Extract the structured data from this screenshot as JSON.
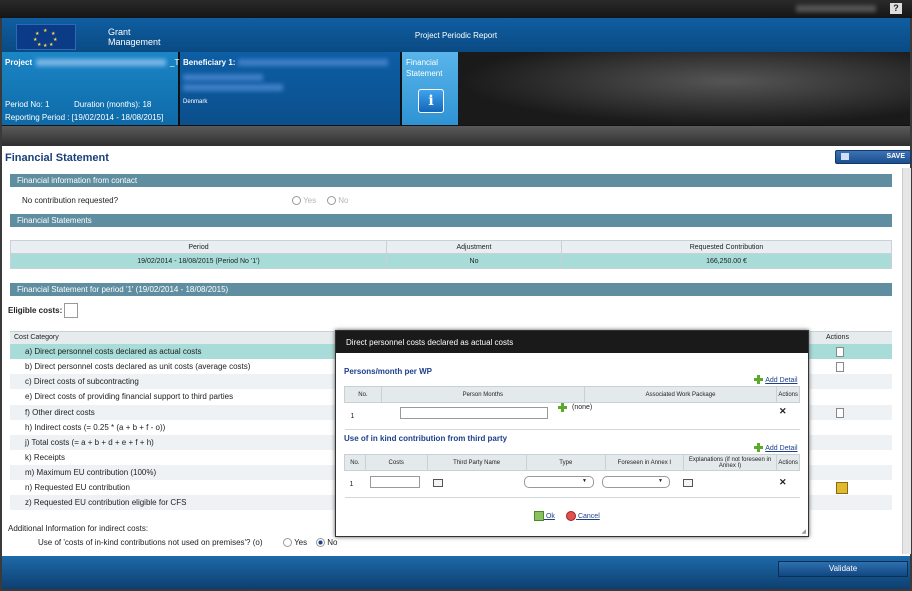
{
  "topbar": {
    "help": "?"
  },
  "branding": {
    "name_line1": "Grant",
    "name_line2": "Management",
    "app_title": "Project Periodic Report"
  },
  "header": {
    "project_label": "Project",
    "project_suffix": "_T",
    "period_no": "Period No: 1",
    "duration": "Duration (months): 18",
    "reporting_period": "Reporting Period : [19/02/2014 - 18/08/2015]",
    "beneficiary_label": "Beneficiary 1:",
    "beneficiary_country": "Denmark",
    "financial_tab_line1": "Financial",
    "financial_tab_line2": "Statement",
    "info_icon": "i"
  },
  "page": {
    "title": "Financial Statement",
    "save_label": "SAVE"
  },
  "contact_section": {
    "title": "Financial information from contact",
    "question": "No contribution requested?",
    "yes": "Yes",
    "no": "No"
  },
  "statements_section": {
    "title": "Financial Statements",
    "columns": [
      "Period",
      "Adjustment",
      "Requested Contribution"
    ],
    "rows": [
      [
        "19/02/2014 - 18/08/2015 (Period No '1')",
        "No",
        "166,250.00 €"
      ]
    ]
  },
  "period_section": {
    "title": "Financial Statement for period '1' (19/02/2014 - 18/08/2015)",
    "eligible_costs": "Eligible costs:"
  },
  "cost_table": {
    "header_category": "Cost Category",
    "header_actions": "Actions",
    "rows": [
      "a) Direct personnel costs declared as actual costs",
      "b) Direct personnel costs declared as unit costs (average costs)",
      "c) Direct costs of subcontracting",
      "e) Direct costs of providing financial support to third parties",
      "f) Other direct costs",
      "h) Indirect costs (= 0.25 * (a + b + f - o))",
      "j) Total costs (= a + b + d + e + f + h)",
      "k) Receipts",
      "m) Maximum EU contribution (100%)",
      "n) Requested EU contribution",
      "z) Requested EU contribution eligible for CFS"
    ]
  },
  "additional": {
    "title": "Additional Information for indirect costs:",
    "question": "Use of 'costs of in-kind contributions not used on premises'? (o)",
    "yes": "Yes",
    "no": "No"
  },
  "footer": {
    "validate": "Validate"
  },
  "modal": {
    "title": "Direct personnel costs declared as actual costs",
    "persons_title": "Persons/month per WP",
    "add_detail": "Add Detail",
    "persons_columns": [
      "No.",
      "Person Months",
      "Associated Work Package",
      "Actions"
    ],
    "persons_row_no": "1",
    "persons_row_wp": "(none)",
    "inkind_title": "Use of in kind contribution from third party",
    "inkind_columns": [
      "No.",
      "Costs",
      "Third Party Name",
      "Type",
      "Foreseen in Annex I",
      "Explanations (if not foreseen in Annex I)",
      "Actions"
    ],
    "inkind_row_no": "1",
    "ok": "Ok",
    "cancel": "Cancel"
  }
}
